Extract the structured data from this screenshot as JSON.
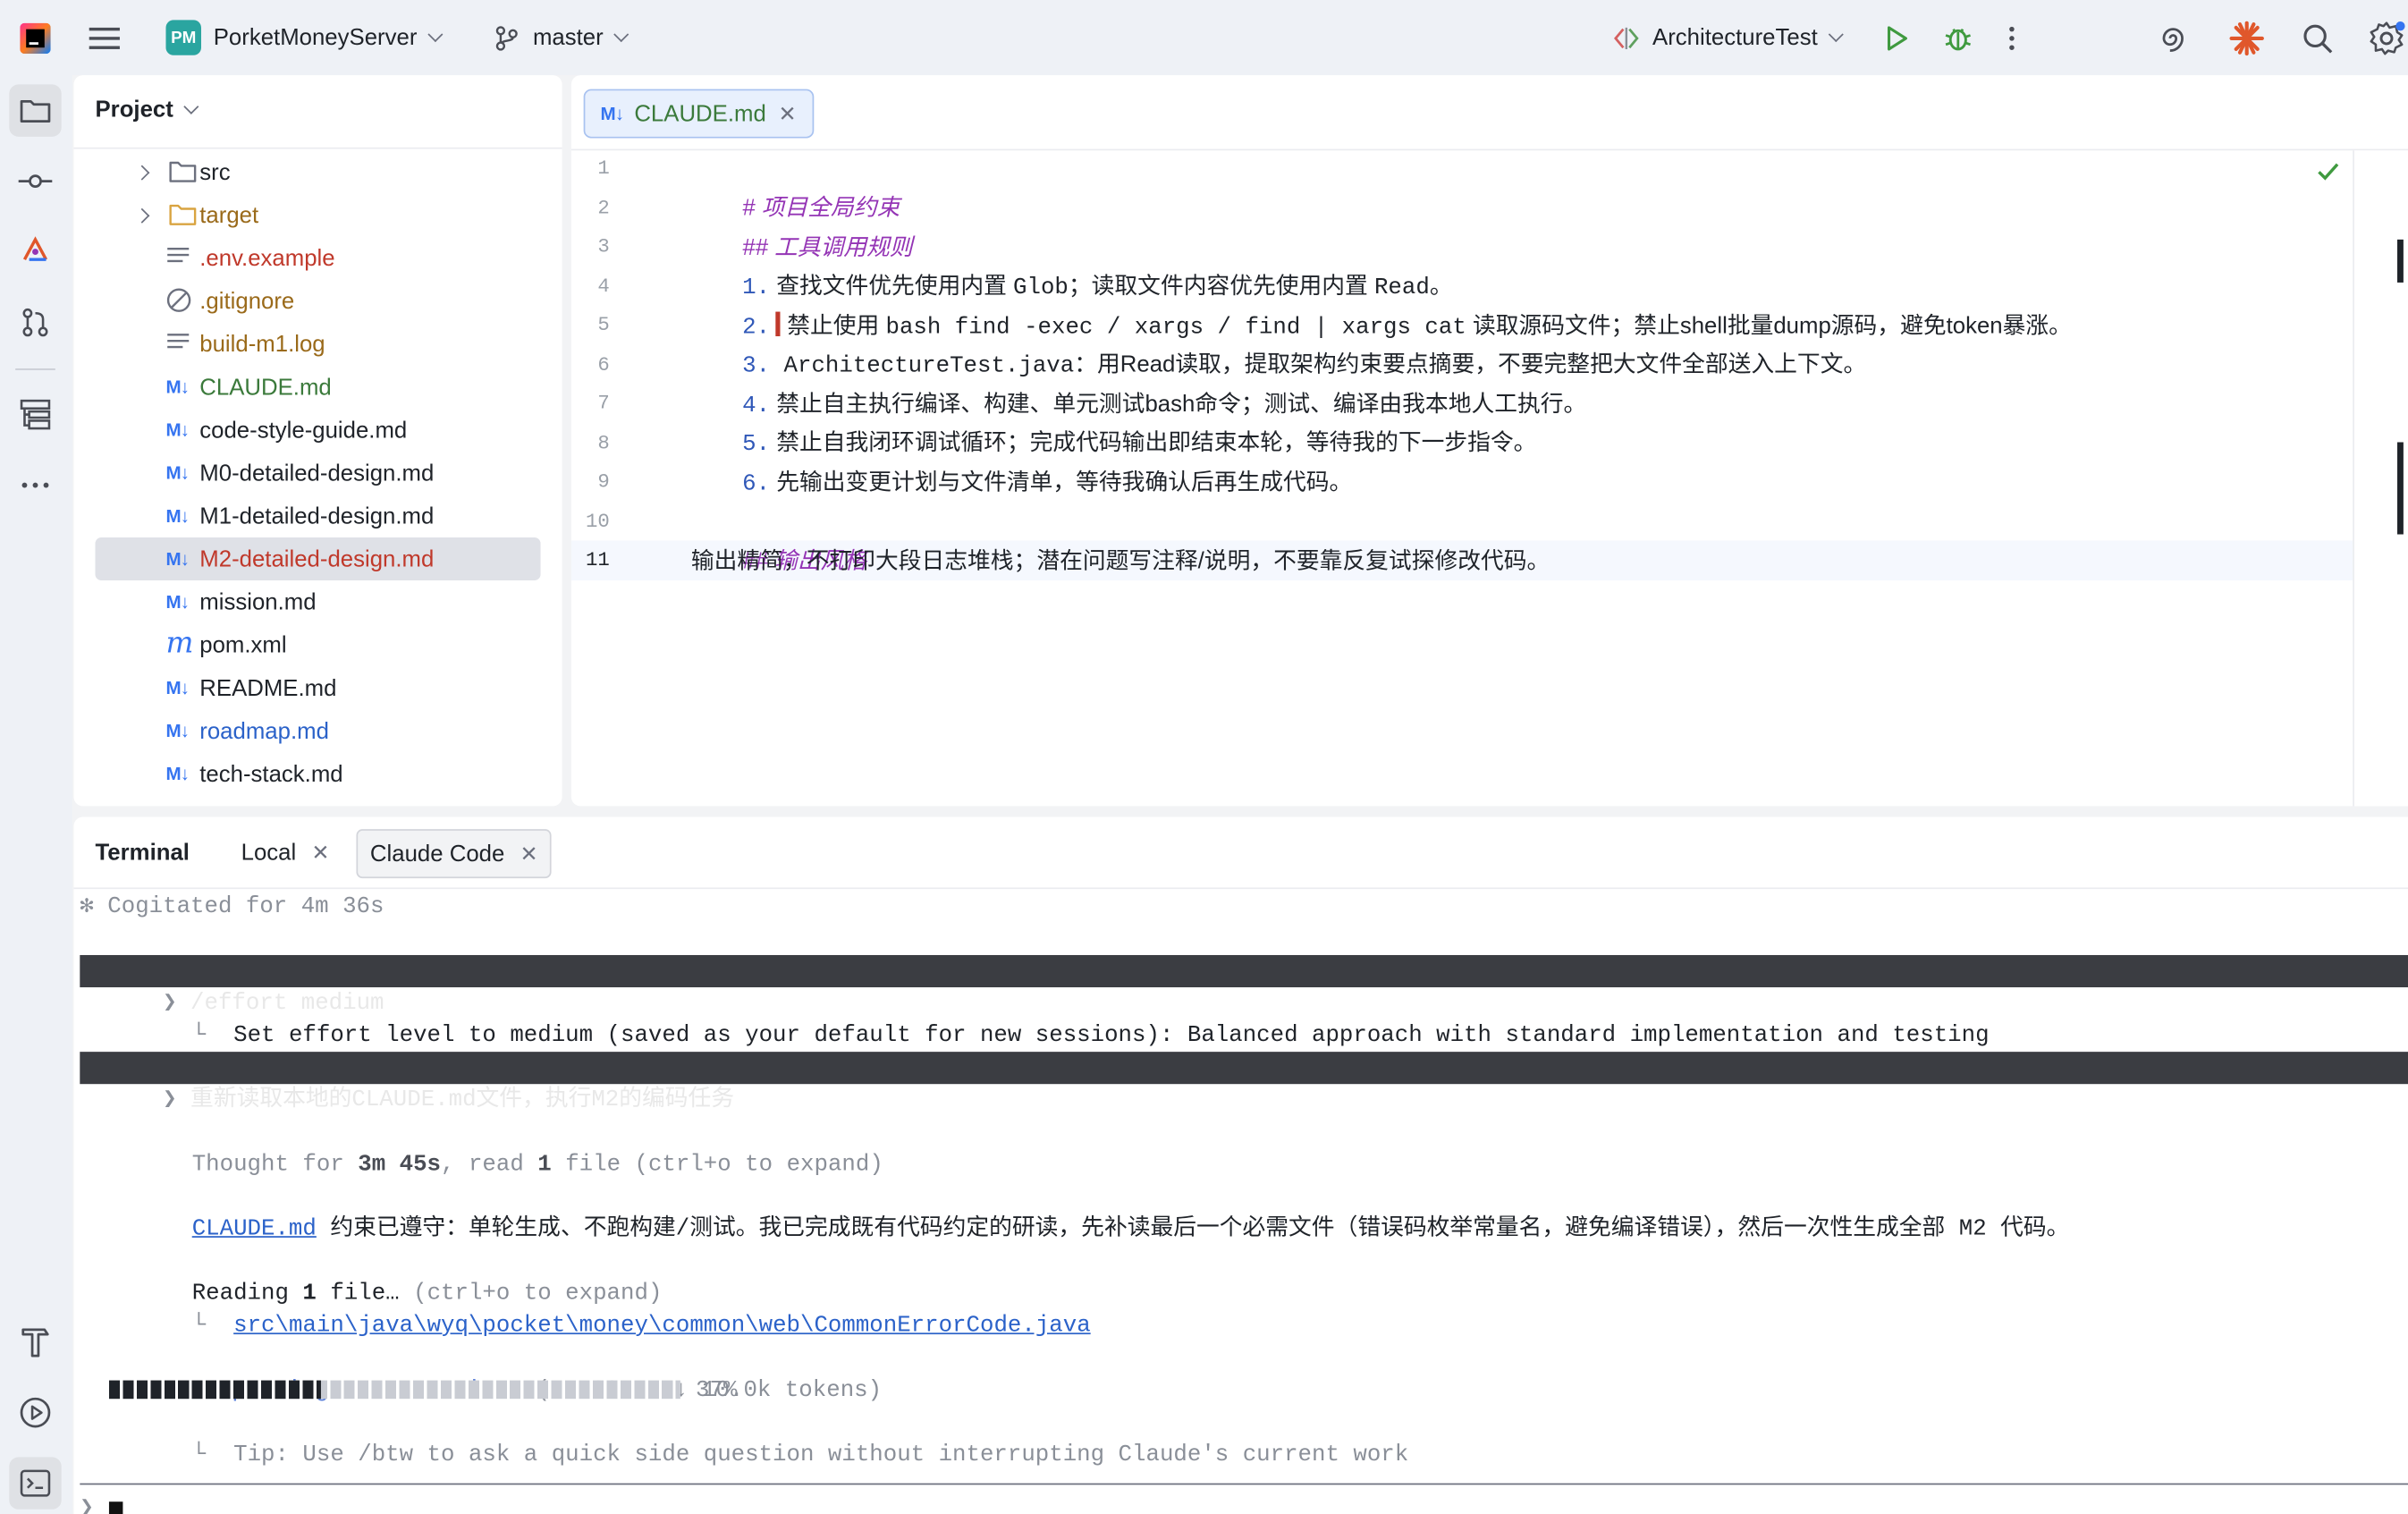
{
  "titlebar": {
    "project_badge": "PM",
    "project_name": "PorketMoneyServer",
    "branch": "master",
    "run_config": "ArchitectureTest"
  },
  "project_panel": {
    "title": "Project",
    "items": [
      {
        "label": "src",
        "kind": "folder",
        "color": "#1f2329"
      },
      {
        "label": "target",
        "kind": "folder",
        "color": "#9a6a1a"
      },
      {
        "label": ".env.example",
        "kind": "text",
        "color": "#c0392b"
      },
      {
        "label": ".gitignore",
        "kind": "ignore",
        "color": "#9a6a1a"
      },
      {
        "label": "build-m1.log",
        "kind": "text",
        "color": "#9a6a1a"
      },
      {
        "label": "CLAUDE.md",
        "kind": "md",
        "color": "#3b7a3b"
      },
      {
        "label": "code-style-guide.md",
        "kind": "md",
        "color": "#1f2329"
      },
      {
        "label": "M0-detailed-design.md",
        "kind": "md",
        "color": "#1f2329"
      },
      {
        "label": "M1-detailed-design.md",
        "kind": "md",
        "color": "#1f2329"
      },
      {
        "label": "M2-detailed-design.md",
        "kind": "md",
        "color": "#c0392b"
      },
      {
        "label": "mission.md",
        "kind": "md",
        "color": "#1f2329"
      },
      {
        "label": "pom.xml",
        "kind": "maven",
        "color": "#1f2329"
      },
      {
        "label": "README.md",
        "kind": "md",
        "color": "#1f2329"
      },
      {
        "label": "roadmap.md",
        "kind": "md",
        "color": "#2b62c9"
      },
      {
        "label": "tech-stack.md",
        "kind": "md",
        "color": "#1f2329"
      }
    ]
  },
  "editor": {
    "tab_label": "CLAUDE.md",
    "tab_icon": "M↓",
    "line_numbers": [
      "1",
      "2",
      "3",
      "4",
      "5",
      "6",
      "7",
      "8",
      "9",
      "10",
      "11"
    ],
    "lines": {
      "l1_mark": "#",
      "l1_text": "项目全局约束",
      "l2_mark": "##",
      "l2_text": "工具调用规则",
      "l3_num": "1.",
      "l3_a": " 查找文件优先使用内置 ",
      "l3_b": "Glob",
      "l3_c": "；读取文件内容优先使用内置 ",
      "l3_d": "Read",
      "l3_e": "。",
      "l4_num": "2.",
      "l4_a": " 禁止使用 ",
      "l4_b": "bash find -exec / xargs / find | xargs cat",
      "l4_c": " 读取源码文件；禁止shell批量dump源码，避免token暴涨。",
      "l5_num": "3.",
      "l5_a": " ArchitectureTest.java",
      "l5_b": "：用Read读取，提取架构约束要点摘要，不要完整把大文件全部送入上下文。",
      "l6_num": "4.",
      "l6_a": " 禁止自主执行编译、构建、单元测试bash命令；测试、编译由我本地人工执行。",
      "l7_num": "5.",
      "l7_a": " 禁止自我闭环调试循环；完成代码输出即结束本轮，等待我的下一步指令。",
      "l8_num": "6.",
      "l8_a": " 先输出变更计划与文件清单，等待我确认后再生成代码。",
      "l10_mark": "##",
      "l10_text": "输出风格",
      "l11_text": "输出精简，不打印大段日志堆栈；潜在问题写注释/说明，不要靠反复试探修改代码。"
    }
  },
  "terminal": {
    "title": "Terminal",
    "tabs": [
      "Local",
      "Claude Code"
    ],
    "lines": {
      "cogitated": "✻ Cogitated for 4m 36s",
      "prompt1_mark": "❯",
      "prompt1": " /effort medium",
      "effort_result": "  Set effort level to medium (saved as your default for new sessions): Balanced approach with standard implementation and testing",
      "prompt2_mark": "❯",
      "prompt2": " 重新读取本地的CLAUDE.md文件，执行M2的编码任务",
      "thought_a": "Thought for ",
      "thought_b": "3m 45s",
      "thought_c": ", read ",
      "thought_d": "1",
      "thought_e": " file (ctrl+o to expand)",
      "claude_link": "CLAUDE.md",
      "claude_rest": " 约束已遵守：单轮生成、不跑构建/测试。我已完成既有代码约定的研读，先补读最后一个必需文件（错误码枚举常量名，避免编译错误），然后一次性生成全部 M2 代码。",
      "reading_a": "Reading ",
      "reading_b": "1",
      "reading_c": " file…",
      "reading_d": " (ctrl+o to expand)",
      "path_prefix": "  ",
      "path": "src\\main\\java\\wyq\\pocket\\money\\common\\web\\CommonErrorCode.java",
      "compacting_a": "✻ Compacting conversation…",
      "compacting_b": " (4m 30s · ↓ 10.0k tokens)",
      "progress_pct": "37%",
      "tip": "  Tip: Use /btw to ask a quick side question without interrupting Claude's current work"
    },
    "progress": 0.37
  }
}
